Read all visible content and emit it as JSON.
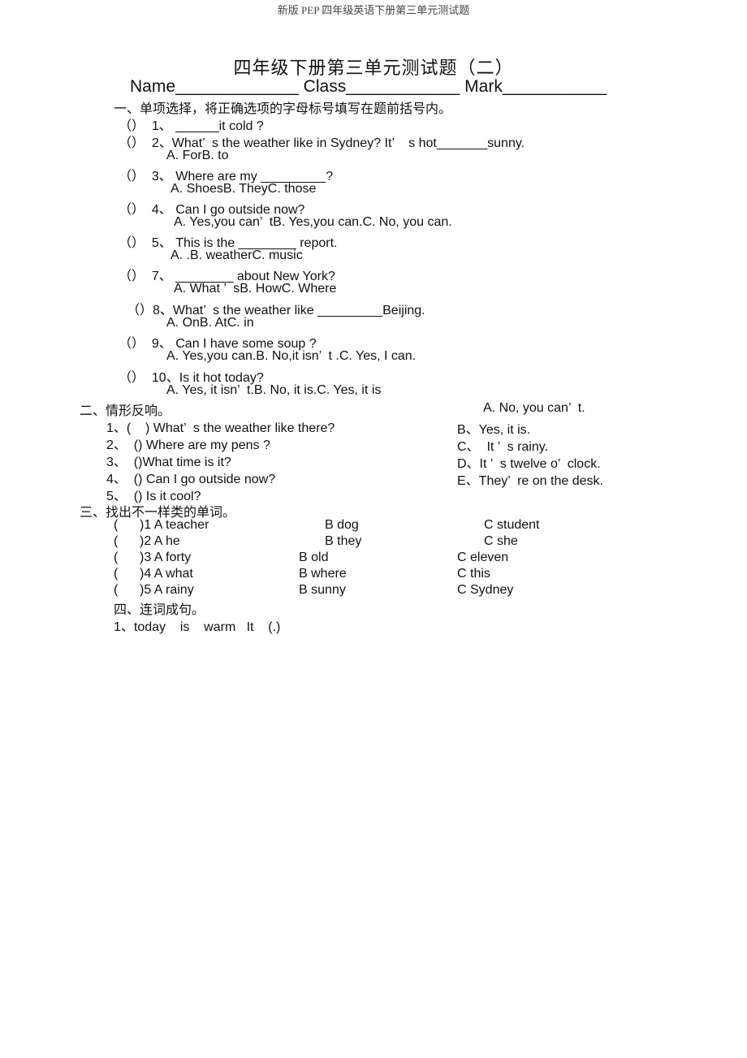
{
  "page_header": "新版 PEP 四年级英语下册第三单元测试题",
  "title": "四年级下册第三单元测试题（二）",
  "meta_line": "Name_____________ Class____________ Mark___________",
  "section1": {
    "heading": "一、单项选择，将正确选项的字母标号填写在题前括号内。",
    "lines": [
      "（）  1、 ______it cold ?",
      "（）  2、What’  s the weather like in Sydney? It’    s hot_______sunny.",
      "A. ForB. to",
      "（）  3、 Where are my _________?",
      "A. ShoesB. TheyC. those",
      "（）  4、 Can I go outside now?",
      "A. Yes,you can’  tB. Yes,you can.C. No, you can.",
      "（）  5、 This is the ________ report.",
      "A. .B. weatherC. music",
      "（）  7、 ________ about New York?",
      "A. What ’  sB. HowC. Where",
      "（）8、What’  s the weather like _________Beijing.",
      "A. OnB. AtC. in",
      "（）  9、 Can I have some soup ?",
      "A. Yes,you can.B. No,it isn’  t .C. Yes, I can.",
      "（）  10、Is it hot today?",
      "A. Yes, it isn’  t.B. No, it is.C. Yes, it is"
    ]
  },
  "section2": {
    "heading": "二、情形反响。",
    "questions": [
      "1、(    ) What’  s the weather like there?",
      "2、  () Where are my pens ?",
      "3、  ()What time is it?",
      "4、  () Can I go outside now?",
      "5、  () Is it cool?"
    ],
    "answers": [
      "A. No, you can’  t.",
      "B、Yes, it is.",
      "C、  It ’  s rainy.",
      "D、It ’  s twelve o’  clock.",
      "E、They’  re on the desk."
    ]
  },
  "section3": {
    "heading": "三、找出不一样类的单词。",
    "rows": [
      {
        "a": "(      )1 A teacher",
        "b": "B dog",
        "c": "C student"
      },
      {
        "a": "(      )2 A he",
        "b": "B they",
        "c": "C she"
      },
      {
        "a": "(      )3 A forty",
        "b": "B old",
        "c": "C eleven"
      },
      {
        "a": "(      )4 A what",
        "b": "B where",
        "c": "C this"
      },
      {
        "a": "(      )5 A rainy",
        "b": "B sunny",
        "c": "C Sydney"
      }
    ]
  },
  "section4": {
    "heading": "四、连词成句。",
    "lines": [
      "1、today    is    warm   It    (.)"
    ]
  }
}
